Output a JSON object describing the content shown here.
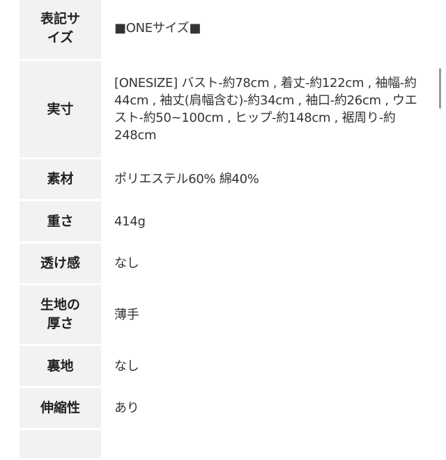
{
  "spec_table": {
    "rows": [
      {
        "label": "表記サイズ",
        "value": "■ONEサイズ■"
      },
      {
        "label": "実寸",
        "value": "[ONESIZE] バスト-約78cm , 着丈-約122cm , 袖幅-約44cm , 袖丈(肩幅含む)-約34cm , 袖口-約26cm , ウエスト-約50~100cm , ヒップ-約148cm , 裾周り-約248cm"
      },
      {
        "label": "素材",
        "value": "ポリエステル60% 綿40%"
      },
      {
        "label": "重さ",
        "value": "414g"
      },
      {
        "label": "透け感",
        "value": "なし"
      },
      {
        "label": "生地の厚さ",
        "value": "薄手"
      },
      {
        "label": "裏地",
        "value": "なし"
      },
      {
        "label": "伸縮性",
        "value": "あり"
      },
      {
        "label": "",
        "value": ""
      }
    ]
  }
}
